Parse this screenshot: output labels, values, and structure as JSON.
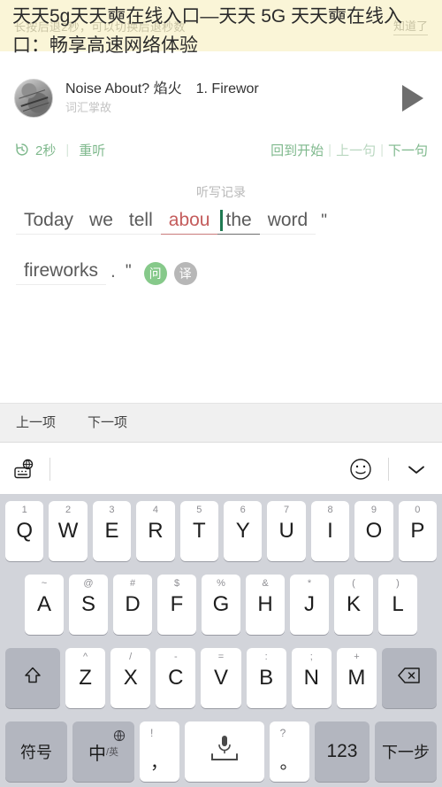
{
  "banner": {
    "message": "长按后退2秒，可以切换后退秒数",
    "dismiss_label": "知道了"
  },
  "page_title": "天天5g天天奭在线入口—天天 5G 天天奭在线入口：畅享高速网络体验",
  "player": {
    "album_art_name": "album-art",
    "track_title": "Noise About? 焰火　1. Firewor",
    "channel": "词汇掌故",
    "play_icon": "play-icon"
  },
  "transport": {
    "rewind_icon": "rewind-clock-icon",
    "rewind_seconds": "2秒",
    "replay_label": "重听",
    "back_to_start": "回到开始",
    "prev_sentence": "上一句",
    "next_sentence": "下一句",
    "separator": "|"
  },
  "dictation": {
    "section_label": "听写记录",
    "line1": [
      {
        "text": "Today",
        "state": "normal"
      },
      {
        "text": "we",
        "state": "normal"
      },
      {
        "text": "tell",
        "state": "normal"
      },
      {
        "text": "abou",
        "state": "wrong"
      },
      {
        "text": "the",
        "state": "active"
      },
      {
        "text": "word",
        "state": "normal"
      },
      {
        "text": "\"",
        "state": "quote"
      }
    ],
    "line2": [
      {
        "text": "fireworks",
        "state": "normal"
      },
      {
        "text": ".",
        "state": "punct"
      },
      {
        "text": "\"",
        "state": "quote"
      }
    ],
    "ask_chip": "问",
    "translate_chip": "译"
  },
  "itembar": {
    "prev_item": "上一项",
    "next_item": "下一项"
  },
  "keyboard_toolbar": {
    "language_icon": "keyboard-globe-icon",
    "emoji_icon": "smiley-icon",
    "collapse_icon": "chevron-down-icon"
  },
  "keyboard": {
    "row1": [
      {
        "sup": "1",
        "label": "Q"
      },
      {
        "sup": "2",
        "label": "W"
      },
      {
        "sup": "3",
        "label": "E"
      },
      {
        "sup": "4",
        "label": "R"
      },
      {
        "sup": "5",
        "label": "T"
      },
      {
        "sup": "6",
        "label": "Y"
      },
      {
        "sup": "7",
        "label": "U"
      },
      {
        "sup": "8",
        "label": "I"
      },
      {
        "sup": "9",
        "label": "O"
      },
      {
        "sup": "0",
        "label": "P"
      }
    ],
    "row2": [
      {
        "sup": "~",
        "label": "A"
      },
      {
        "sup": "@",
        "label": "S"
      },
      {
        "sup": "#",
        "label": "D"
      },
      {
        "sup": "$",
        "label": "F"
      },
      {
        "sup": "%",
        "label": "G"
      },
      {
        "sup": "&",
        "label": "H"
      },
      {
        "sup": "*",
        "label": "J"
      },
      {
        "sup": "(",
        "label": "K"
      },
      {
        "sup": ")",
        "label": "L"
      }
    ],
    "row3": [
      {
        "sup": "^",
        "label": "Z"
      },
      {
        "sup": "/",
        "label": "X"
      },
      {
        "sup": "-",
        "label": "C"
      },
      {
        "sup": "=",
        "label": "V"
      },
      {
        "sup": ":",
        "label": "B"
      },
      {
        "sup": ";",
        "label": "N"
      },
      {
        "sup": "+",
        "label": "M"
      }
    ],
    "shift_icon": "shift-icon",
    "backspace_icon": "backspace-icon",
    "symbols_key": "符号",
    "lang_key_main": "中",
    "lang_key_sub": "/英",
    "lang_globe_icon": "globe-icon",
    "comma_key_sup": "!",
    "comma_key_main": "，",
    "space_icon": "microphone-icon",
    "period_key_sup": "?",
    "period_key_main": "。",
    "numeric_key": "123",
    "next_key": "下一步"
  },
  "colors": {
    "banner_bg": "#faf5d7",
    "accent_green": "#7fb98d",
    "error_red": "#c45c5c",
    "cursor_green": "#1f7a52",
    "keyboard_bg": "#d2d4da",
    "fn_key_bg": "#b3b6bf"
  }
}
